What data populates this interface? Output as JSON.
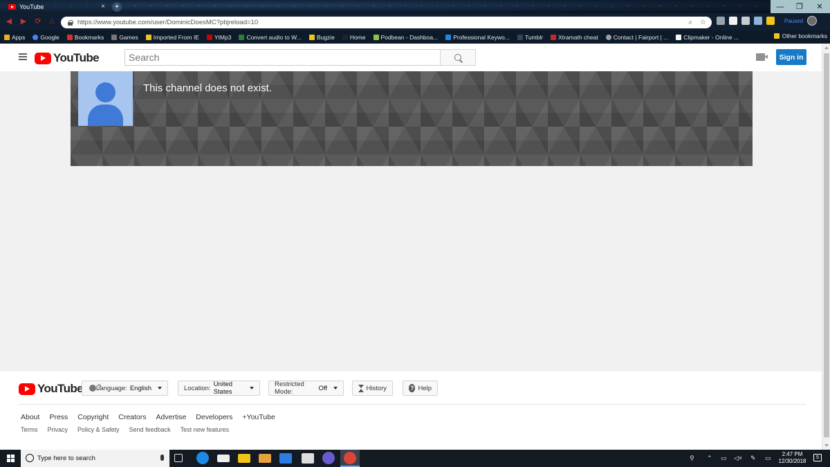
{
  "browser": {
    "tab_title": "YouTube",
    "tab_close": "×",
    "new_tab": "+",
    "url": "https://www.youtube.com/user/DominicDoesMC?pbjreload=10",
    "profile_status": "Paused",
    "window_controls": {
      "minimize": "—",
      "restore": "❐",
      "close": "✕"
    },
    "bookmarks": [
      {
        "label": "Apps",
        "color": "#e8b21e"
      },
      {
        "label": "Google",
        "color": "#4285f4"
      },
      {
        "label": "Bookmarks",
        "color": "#d93025"
      },
      {
        "label": "Games",
        "color": "#777777"
      },
      {
        "label": "Imported From IE",
        "color": "#f0c419"
      },
      {
        "label": "YtMp3",
        "color": "#cc0000"
      },
      {
        "label": "Convert audio to W...",
        "color": "#2e7d32"
      },
      {
        "label": "Bugzie",
        "color": "#f0c419"
      },
      {
        "label": "Home",
        "color": "#222222"
      },
      {
        "label": "Podbean - Dashboa...",
        "color": "#8bc34a"
      },
      {
        "label": "Professional Keywo...",
        "color": "#1e88e5"
      },
      {
        "label": "Tumblr",
        "color": "#35465c"
      },
      {
        "label": "Xtramath cheat",
        "color": "#c62828"
      },
      {
        "label": "Contact | Fairport | ...",
        "color": "#9e9e9e"
      },
      {
        "label": "Clipmaker - Online ...",
        "color": "#f5f5f5"
      }
    ],
    "other_bookmarks": "Other bookmarks"
  },
  "masthead": {
    "logo_text": "YouTube",
    "search_placeholder": "Search",
    "signin_label": "Sign in"
  },
  "channel": {
    "message": "This channel does not exist."
  },
  "footer": {
    "logo_text": "YouTube",
    "language_label": "Language:",
    "language_value": "English",
    "location_label": "Location:",
    "location_value": "United States",
    "restricted_label": "Restricted Mode:",
    "restricted_value": "Off",
    "history_label": "History",
    "help_label": "Help",
    "links_primary": [
      "About",
      "Press",
      "Copyright",
      "Creators",
      "Advertise",
      "Developers",
      "+YouTube"
    ],
    "links_secondary": [
      "Terms",
      "Privacy",
      "Policy & Safety",
      "Send feedback",
      "Test new features"
    ]
  },
  "taskbar": {
    "search_placeholder": "Type here to search",
    "time": "2:47 PM",
    "date": "12/30/2018",
    "notification_count": "5"
  },
  "colors": {
    "youtube_red": "#ff0000",
    "signin_blue": "#167ac6",
    "banner_gray": "#5a5a5a",
    "avatar_blue": "#3e7ad6"
  }
}
